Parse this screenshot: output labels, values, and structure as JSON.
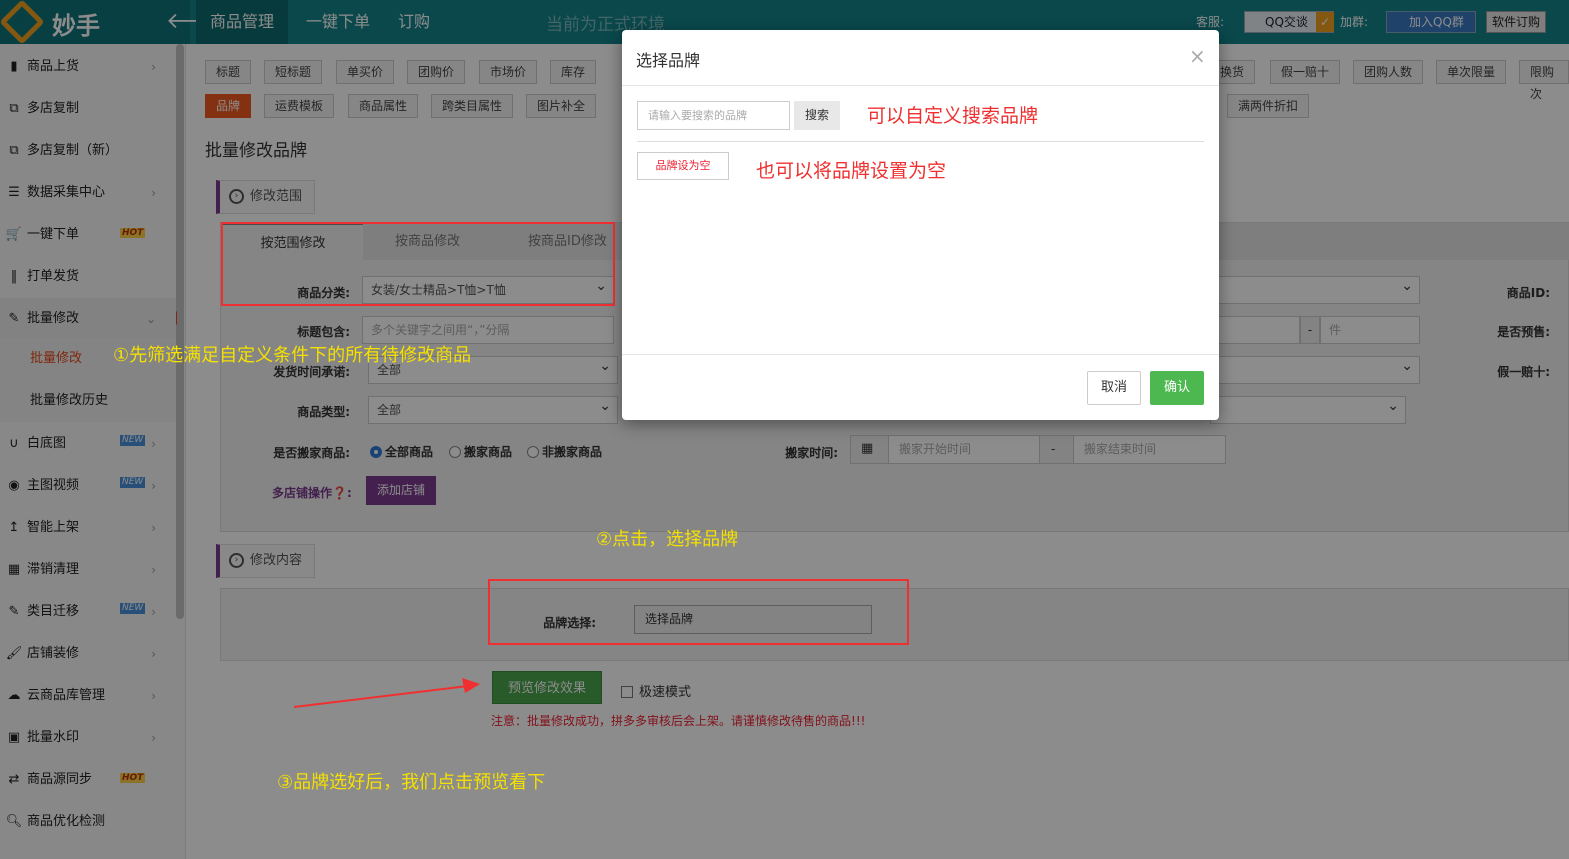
{
  "header": {
    "logo_text": "妙手",
    "back_icon": "arrow-left-icon",
    "nav": [
      "商品管理",
      "一键下单",
      "订购"
    ],
    "env_text": "当前为正式环境",
    "service_label": "客服:",
    "qq_chat": "QQ交谈",
    "group_label": "加群:",
    "qq_group": "加入QQ群",
    "buy_button": "软件订购",
    "accent_color": "#13848a"
  },
  "sidebar": {
    "items": [
      {
        "label": "商品上货",
        "icon": "clipboard-icon"
      },
      {
        "label": "多店复制",
        "icon": "copy-icon"
      },
      {
        "label": "多店复制（新）",
        "icon": "copy-icon"
      },
      {
        "label": "数据采集中心",
        "icon": "database-icon"
      },
      {
        "label": "一键下单",
        "icon": "cart-icon",
        "badge": "HOT"
      },
      {
        "label": "打单发货",
        "icon": "barcode-icon"
      },
      {
        "label": "批量修改",
        "icon": "edit-icon"
      },
      {
        "label": "批量修改",
        "icon": ""
      },
      {
        "label": "批量修改历史",
        "icon": ""
      },
      {
        "label": "白底图",
        "icon": "magnet-icon",
        "badge": "NEW"
      },
      {
        "label": "主图视频",
        "icon": "play-icon",
        "badge": "NEW"
      },
      {
        "label": "智能上架",
        "icon": "upload-icon"
      },
      {
        "label": "滞销清理",
        "icon": "grid-icon"
      },
      {
        "label": "类目迁移",
        "icon": "edit-icon",
        "badge": "NEW"
      },
      {
        "label": "店铺装修",
        "icon": "brush-icon"
      },
      {
        "label": "云商品库管理",
        "icon": "cloud-icon"
      },
      {
        "label": "批量水印",
        "icon": "image-icon"
      },
      {
        "label": "商品源同步",
        "icon": "sync-icon",
        "badge": "HOT"
      },
      {
        "label": "商品优化检测",
        "icon": "search-icon"
      }
    ]
  },
  "tags_row1": [
    "标题",
    "短标题",
    "单买价",
    "团购价",
    "市场价",
    "库存",
    "换货",
    "假一赔十",
    "团购人数",
    "单次限量",
    "限购次"
  ],
  "tags_row2": [
    "品牌",
    "运费模板",
    "商品属性",
    "跨类目属性",
    "图片补全",
    "满两件折扣"
  ],
  "page_title": "批量修改品牌",
  "section1": "修改范围",
  "tabs": [
    "按范围修改",
    "按商品修改",
    "按商品ID修改"
  ],
  "filters": {
    "category_label": "商品分类:",
    "category_value": "女装/女士精品>T恤>T恤",
    "title_label": "标题包含:",
    "title_placeholder": "多个关键字之间用“，”分隔",
    "ship_label": "发货时间承诺:",
    "ship_value": "全部",
    "type_label": "商品类型:",
    "type_value": "全部",
    "move_label": "是否搬家商品:",
    "move_options": [
      "全部商品",
      "搬家商品",
      "非搬家商品"
    ],
    "multi_label": "多店铺操作",
    "add_shop": "添加店铺",
    "move_time_label": "搬家时间:",
    "move_start": "搬家开始时间",
    "move_end": "搬家结束时间",
    "product_id_label": "商品ID:",
    "presale_label": "是否预售:",
    "fake_label": "假一赔十:",
    "stock_unit": "件",
    "dash": "-"
  },
  "section2": "修改内容",
  "brand_label": "品牌选择:",
  "brand_button": "选择品牌",
  "preview_button": "预览修改效果",
  "fast_mode": "极速模式",
  "notice": "注意：批量修改成功，拼多多审核后会上架。请谨慎修改待售的商品!!!",
  "annotations": {
    "step1": "①先筛选满足自定义条件下的所有待修改商品",
    "step2": "②点击，选择品牌",
    "step3": "③品牌选好后，我们点击预览看下",
    "modal_note1": "可以自定义搜索品牌",
    "modal_note2": "也可以将品牌设置为空"
  },
  "modal": {
    "title": "选择品牌",
    "close": "×",
    "search_placeholder": "请输入要搜索的品牌",
    "search_button": "搜索",
    "set_empty": "品牌设为空",
    "cancel": "取消",
    "confirm": "确认"
  }
}
